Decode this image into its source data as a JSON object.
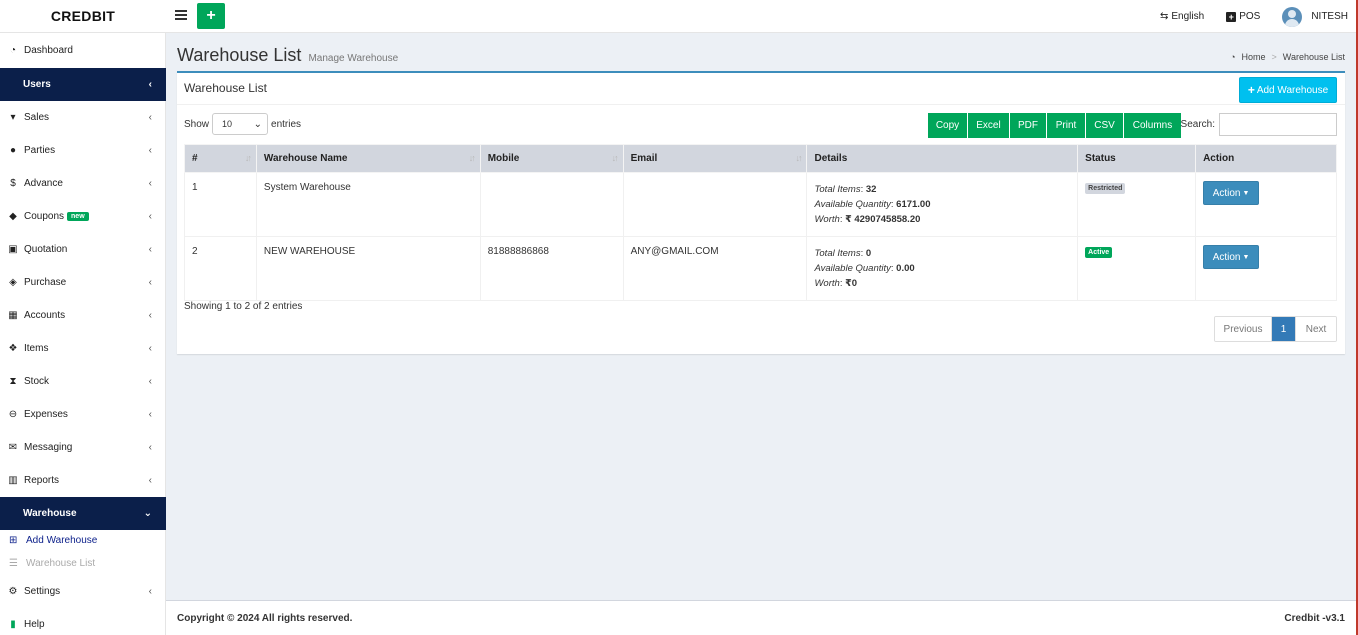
{
  "brand": "CREDBIT",
  "topbar": {
    "language": "English",
    "pos": "POS",
    "user": "NITESH"
  },
  "sidebar": {
    "dashboard": "Dashboard",
    "users": "Users",
    "sales": "Sales",
    "parties": "Parties",
    "advance": "Advance",
    "coupons": "Coupons",
    "coupons_badge": "new",
    "quotation": "Quotation",
    "purchase": "Purchase",
    "accounts": "Accounts",
    "items": "Items",
    "stock": "Stock",
    "expenses": "Expenses",
    "messaging": "Messaging",
    "reports": "Reports",
    "warehouse": "Warehouse",
    "add_warehouse": "Add Warehouse",
    "warehouse_list": "Warehouse List",
    "settings": "Settings",
    "help": "Help"
  },
  "header": {
    "title": "Warehouse List",
    "subtitle": "Manage Warehouse"
  },
  "breadcrumb": {
    "home": "Home",
    "sep": ">",
    "current": "Warehouse List"
  },
  "box": {
    "title": "Warehouse List",
    "add_button": "Add Warehouse",
    "show_label": "Show",
    "entries_value": "10",
    "entries_label": "entries",
    "search_label": "Search:",
    "export_buttons": [
      "Copy",
      "Excel",
      "PDF",
      "Print",
      "CSV",
      "Columns"
    ]
  },
  "table": {
    "headers": [
      "#",
      "Warehouse Name",
      "Mobile",
      "Email",
      "Details",
      "Status",
      "Action"
    ],
    "detail_labels": {
      "total": "Total Items",
      "qty": "Available Quantity",
      "worth": "Worth"
    },
    "rows": [
      {
        "no": "1",
        "name": "System Warehouse",
        "mobile": "",
        "email": "",
        "total_items": "32",
        "available_qty": "6171.00",
        "worth": "₹ 4290745858.20",
        "status": "Restricted",
        "action": "Action"
      },
      {
        "no": "2",
        "name": "NEW WAREHOUSE",
        "mobile": "81888886868",
        "email": "ANY@GMAIL.COM",
        "total_items": "0",
        "available_qty": "0.00",
        "worth": "₹0",
        "status": "Active",
        "action": "Action"
      }
    ]
  },
  "showing": "Showing 1 to 2 of 2 entries",
  "pagination": {
    "previous": "Previous",
    "current": "1",
    "next": "Next"
  },
  "footer": {
    "copyright": "Copyright © 2024 All rights reserved.",
    "version": "Credbit -v3.1"
  },
  "colors": {
    "accent": "#00a65a",
    "sidebar_active": "#0b1f4a",
    "info": "#00c0ef",
    "primary": "#3c8dbc"
  }
}
